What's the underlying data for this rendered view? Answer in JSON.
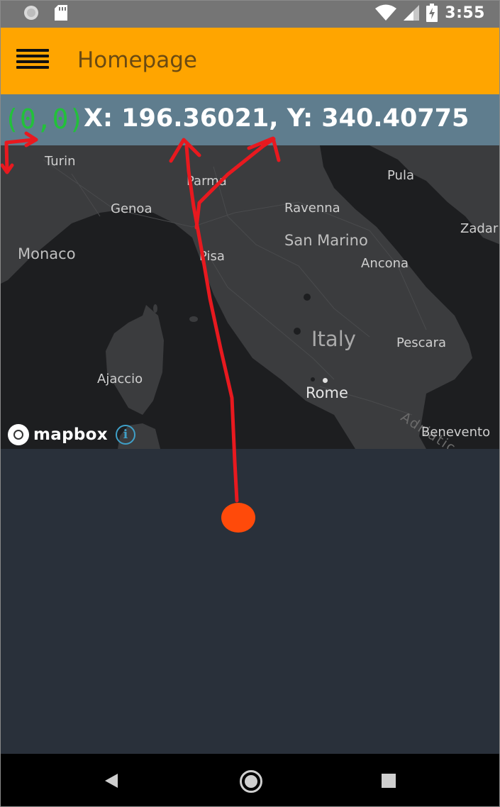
{
  "status_bar": {
    "time": "3:55",
    "icons": [
      "notification-circle-icon",
      "sd-card-icon",
      "wifi-icon",
      "cell-signal-icon",
      "battery-charging-icon"
    ]
  },
  "app_bar": {
    "menu_icon": "hamburger-menu-icon",
    "title": "Homepage",
    "background": "#FFA500"
  },
  "coord_bar": {
    "origin_label": "(0,0)",
    "coordinates": "X: 196.36021, Y: 340.40775",
    "origin_color": "#22c13a"
  },
  "map": {
    "places": {
      "turin": "Turin",
      "parma": "Parma",
      "pula": "Pula",
      "genoa": "Genoa",
      "ravenna": "Ravenna",
      "zadar": "Zadar",
      "monaco": "Monaco",
      "san_marino": "San Marino",
      "pisa": "Pisa",
      "ancona": "Ancona",
      "italy": "Italy",
      "pescara": "Pescara",
      "ajaccio": "Ajaccio",
      "rome": "Rome",
      "benevento": "Benevento"
    },
    "sea_label": "Adriatic Sea",
    "attribution": "mapbox",
    "info_icon": "info-icon"
  },
  "annotation_color": "#e8191f",
  "nav_bar": {
    "icons": [
      "back-icon",
      "home-icon",
      "recent-apps-icon"
    ]
  }
}
